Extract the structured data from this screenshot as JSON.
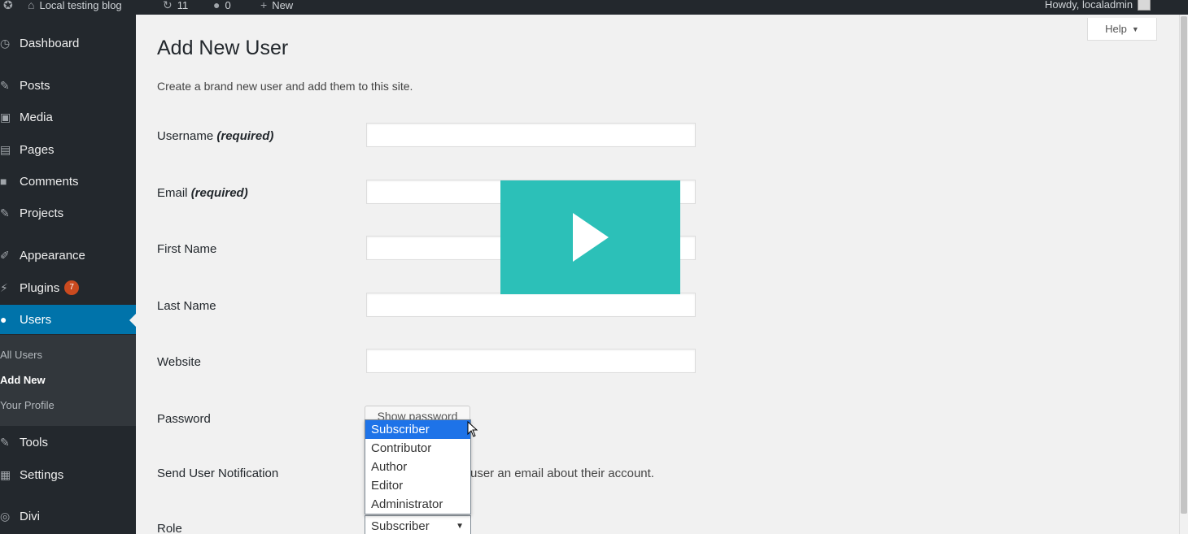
{
  "admin_bar": {
    "site_name": "Local testing blog",
    "updates_count": "11",
    "comments_count": "0",
    "new_label": "New",
    "greeting": "Howdy, localadmin"
  },
  "sidebar": {
    "items": [
      {
        "label": "Dashboard",
        "icon": "dashboard-icon"
      },
      {
        "label": "Posts",
        "icon": "pin-icon"
      },
      {
        "label": "Media",
        "icon": "media-icon"
      },
      {
        "label": "Pages",
        "icon": "page-icon"
      },
      {
        "label": "Comments",
        "icon": "comment-icon"
      },
      {
        "label": "Projects",
        "icon": "pin-icon"
      },
      {
        "label": "Appearance",
        "icon": "brush-icon"
      },
      {
        "label": "Plugins",
        "icon": "plug-icon",
        "badge": "7"
      },
      {
        "label": "Users",
        "icon": "user-icon",
        "current": true
      },
      {
        "label": "Tools",
        "icon": "wrench-icon"
      },
      {
        "label": "Settings",
        "icon": "settings-icon"
      },
      {
        "label": "Divi",
        "icon": "divi-icon"
      }
    ],
    "users_submenu": [
      "All Users",
      "Add New",
      "Your Profile"
    ]
  },
  "help_tab": "Help",
  "page": {
    "title": "Add New User",
    "description": "Create a brand new user and add them to this site."
  },
  "form": {
    "username_label": "Username",
    "email_label": "Email",
    "required_note": "(required)",
    "first_name_label": "First Name",
    "last_name_label": "Last Name",
    "website_label": "Website",
    "password_label": "Password",
    "show_password_button": "Show password",
    "send_notification_label": "Send User Notification",
    "send_notification_text": "user an email about their account.",
    "role_label": "Role",
    "role_value": "Subscriber",
    "role_options": [
      "Subscriber",
      "Contributor",
      "Author",
      "Editor",
      "Administrator"
    ]
  },
  "colors": {
    "sidebar_bg": "#23282d",
    "accent": "#0073aa",
    "play_overlay": "#2cc0b8",
    "option_highlight": "#1e73e8"
  }
}
